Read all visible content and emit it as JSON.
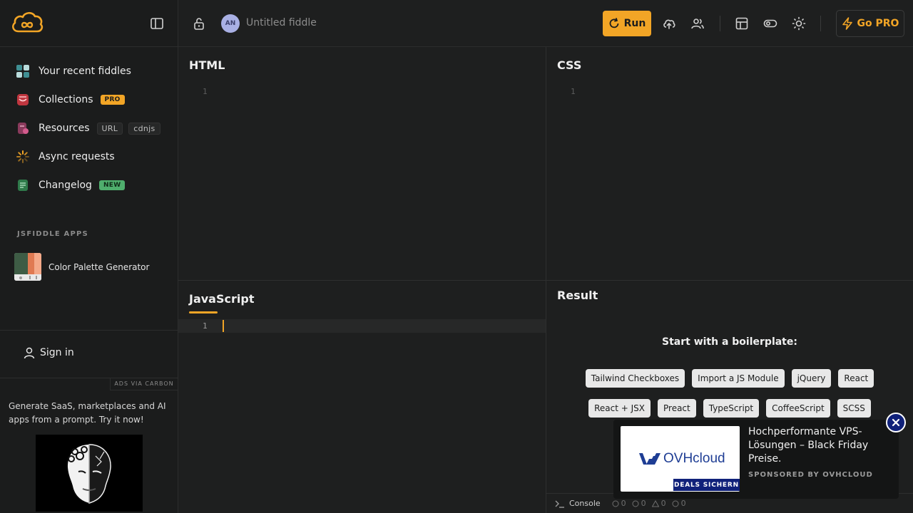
{
  "app": {
    "fiddle_title": "Untitled fiddle",
    "avatar_initials": "AN",
    "accent_color": "#f2a526"
  },
  "sidebar": {
    "logo_icon": "jsfiddle-cloud-logo",
    "items": [
      {
        "label": "Your recent fiddles",
        "icon": "grid-icon"
      },
      {
        "label": "Collections",
        "icon": "box-icon",
        "badge": "PRO"
      },
      {
        "label": "Resources",
        "icon": "file-icon",
        "tags": [
          "URL",
          "cdnjs"
        ]
      },
      {
        "label": "Async requests",
        "icon": "spinner-icon"
      },
      {
        "label": "Changelog",
        "icon": "document-icon",
        "badge": "NEW"
      }
    ],
    "apps_heading": "JSFIDDLE APPS",
    "app_item": "Color Palette Generator",
    "sign_in": "Sign in",
    "ads_via": "ADS VIA CARBON",
    "ad_text": "Generate SaaS, marketplaces and AI apps from a prompt. Try it now!"
  },
  "toolbar": {
    "run_label": "Run",
    "pro_label": "Go PRO"
  },
  "panels": {
    "html": {
      "title": "HTML",
      "line": "1"
    },
    "css": {
      "title": "CSS",
      "line": "1"
    },
    "js": {
      "title": "JavaScript",
      "line": "1"
    },
    "result": {
      "title": "Result"
    }
  },
  "boilerplate": {
    "title": "Start with a boilerplate:",
    "row1": [
      "Tailwind Checkboxes",
      "Import a JS Module",
      "jQuery",
      "React"
    ],
    "row2": [
      "React + JSX",
      "Preact",
      "TypeScript",
      "CoffeeScript",
      "SCSS"
    ]
  },
  "console": {
    "label": "Console",
    "counts": [
      "0",
      "0",
      "0",
      "0"
    ]
  },
  "float_ad": {
    "brand": "OVHcloud",
    "tag": "DEALS SICHERN",
    "headline": "Hochperformante VPS-Lösungen – Black Friday Preise.",
    "sponsor": "SPONSORED BY OVHCLOUD"
  }
}
